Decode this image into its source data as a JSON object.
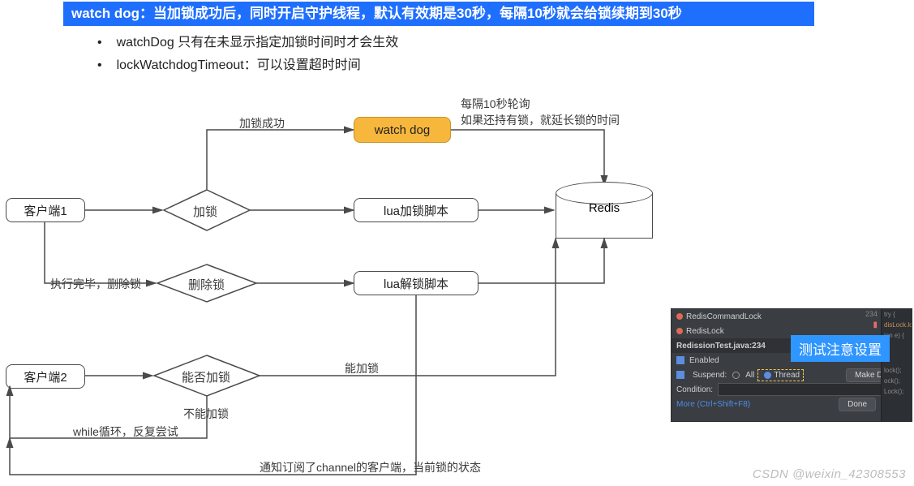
{
  "banner": "watch dog：当加锁成功后，同时开启守护线程，默认有效期是30秒，每隔10秒就会给锁续期到30秒",
  "bullets": [
    "watchDog 只有在未显示指定加锁时间时才会生效",
    "lockWatchdogTimeout：可以设置超时时间"
  ],
  "nodes": {
    "client1": "客户端1",
    "client2": "客户端2",
    "lock": "加锁",
    "delete": "删除锁",
    "canlock": "能否加锁",
    "watchdog": "watch dog",
    "luaLock": "lua加锁脚本",
    "luaUnlock": "lua解锁脚本",
    "redis": "Redis"
  },
  "edgeLabels": {
    "lockSuccess": "加锁成功",
    "executeDone": "执行完毕，删除锁",
    "pollNote1": "每隔10秒轮询",
    "pollNote2": "如果还持有锁，就延长锁的时间",
    "canLockYes": "能加锁",
    "canLockNo": "不能加锁",
    "whileLoop": "while循环，反复尝试",
    "notifyChannel": "通知订阅了channel的客户端，当前锁的状态"
  },
  "ide": {
    "breakpoints": [
      "RedisCommandLock",
      "RedisLock"
    ],
    "file": "RedissionTest.java:234",
    "lineNum": "234",
    "enabled": "Enabled",
    "suspend": "Suspend:",
    "all": "All",
    "thread": "Thread",
    "makeDefault": "Make Default",
    "condition": "Condition:",
    "more": "More (Ctrl+Shift+F8)",
    "done": "Done",
    "code": {
      "try": "try {",
      "lock": "disLock.lock();",
      "catch": "ion e) {",
      "unlock1": "lock();",
      "unlock2": "ock();",
      "unlock3": "Lock();"
    }
  },
  "callout": "测试注意设置",
  "watermark": "CSDN @weixin_42308553"
}
